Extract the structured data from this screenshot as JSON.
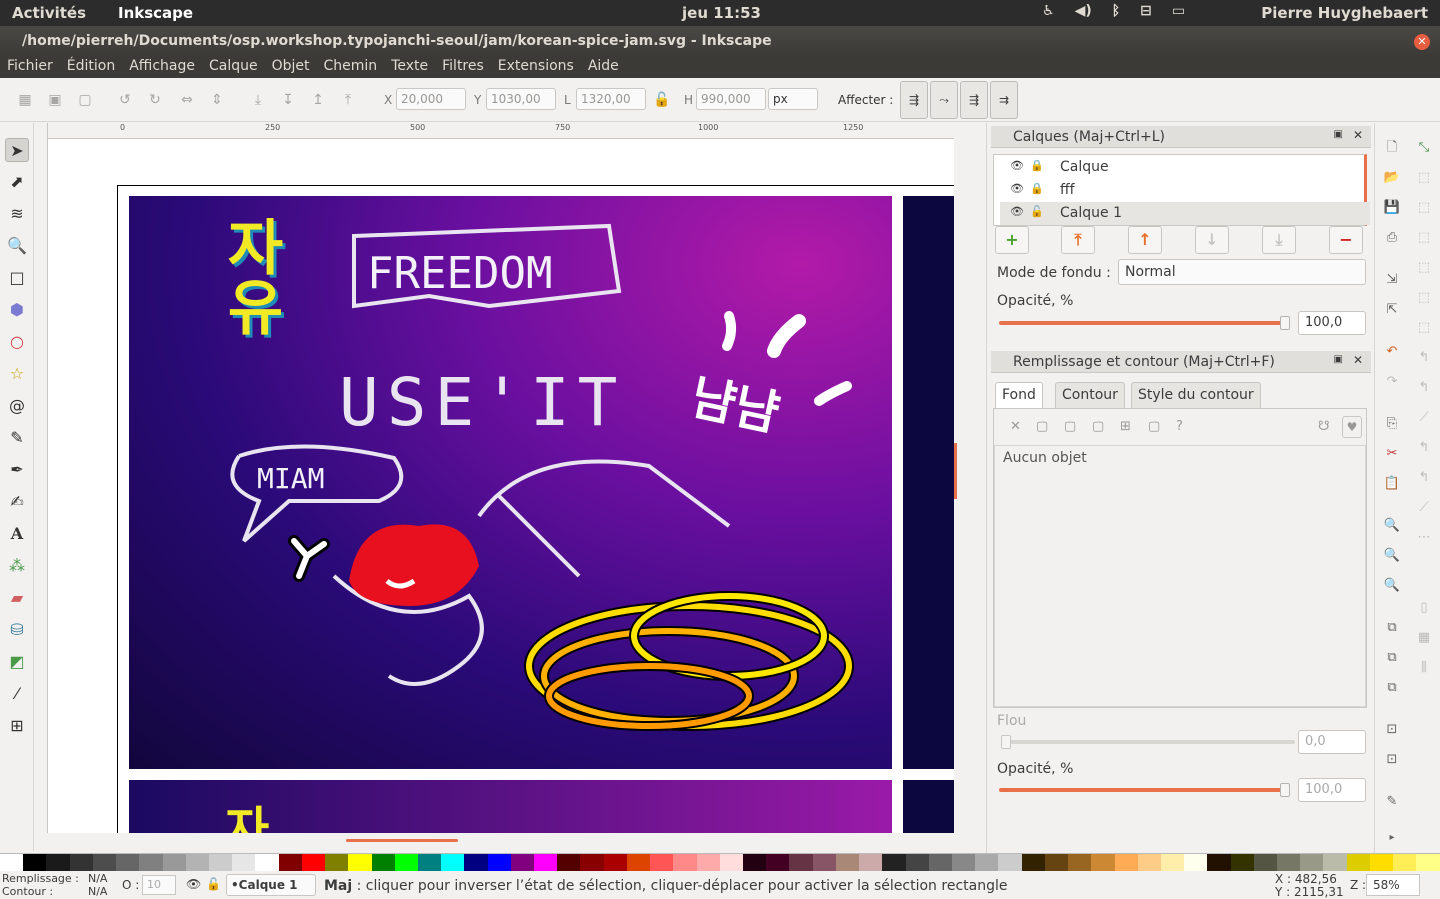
{
  "topbar": {
    "activities": "Activités",
    "app": "Inkscape",
    "clock": "jeu 11:53",
    "user": "Pierre Huyghebaert"
  },
  "window": {
    "title": "/home/pierreh/Documents/osp.workshop.typojanchi-seoul/jam/korean-spice-jam.svg - Inkscape"
  },
  "menu": [
    "Fichier",
    "Édition",
    "Affichage",
    "Calque",
    "Objet",
    "Chemin",
    "Texte",
    "Filtres",
    "Extensions",
    "Aide"
  ],
  "toolbar": {
    "x_label": "X",
    "x_value": "20,000",
    "y_label": "Y",
    "y_value": "1030,00",
    "w_label": "L",
    "w_value": "1320,00",
    "h_label": "H",
    "h_value": "990,000",
    "unit": "px",
    "affect_label": "Affecter :"
  },
  "ruler": {
    "marks": [
      "0",
      "250",
      "500",
      "750",
      "1000",
      "1250"
    ]
  },
  "artwork": {
    "korean_vertical": "자유",
    "korean_lower": "자",
    "freedom": "FREEDOM",
    "use_it": "USE'IT",
    "miam": "MIAM",
    "nam_nam": "냠냠"
  },
  "layers_panel": {
    "title": "Calques (Maj+Ctrl+L)",
    "layers": [
      {
        "name": "Calque"
      },
      {
        "name": "fff"
      },
      {
        "name": "Calque 1"
      }
    ],
    "blend_label": "Mode de fondu :",
    "blend_value": "Normal",
    "opacity_label": "Opacité, %",
    "opacity_value": "100,0",
    "opacity": 1.0
  },
  "fill_panel": {
    "title": "Remplissage et contour (Maj+Ctrl+F)",
    "tabs": [
      "Fond",
      "Contour",
      "Style du contour"
    ],
    "no_object": "Aucun objet",
    "blur_label": "Flou",
    "blur_value": "0,0",
    "blur": 0.0,
    "opacity_label": "Opacité, %",
    "opacity_value": "100,0",
    "opacity": 1.0
  },
  "status": {
    "fill_label": "Remplissage :",
    "fill_value": "N/A",
    "stroke_label": "Contour :",
    "stroke_value": "N/A",
    "o_label": "O :",
    "o_value": "10",
    "layer": "•Calque 1",
    "msg_key": "Maj",
    "message": " : cliquer pour inverser l’état de sélection, cliquer-déplacer pour activer la sélection rectangle",
    "x_coord": "X :  482,56",
    "y_coord": "Y : 2115,31",
    "zoom_label": "Z :",
    "zoom": "58%"
  },
  "colors": {
    "accent": "#e75d3f",
    "selected_layer": "#e6e5e2",
    "slider": "#e8704a"
  }
}
